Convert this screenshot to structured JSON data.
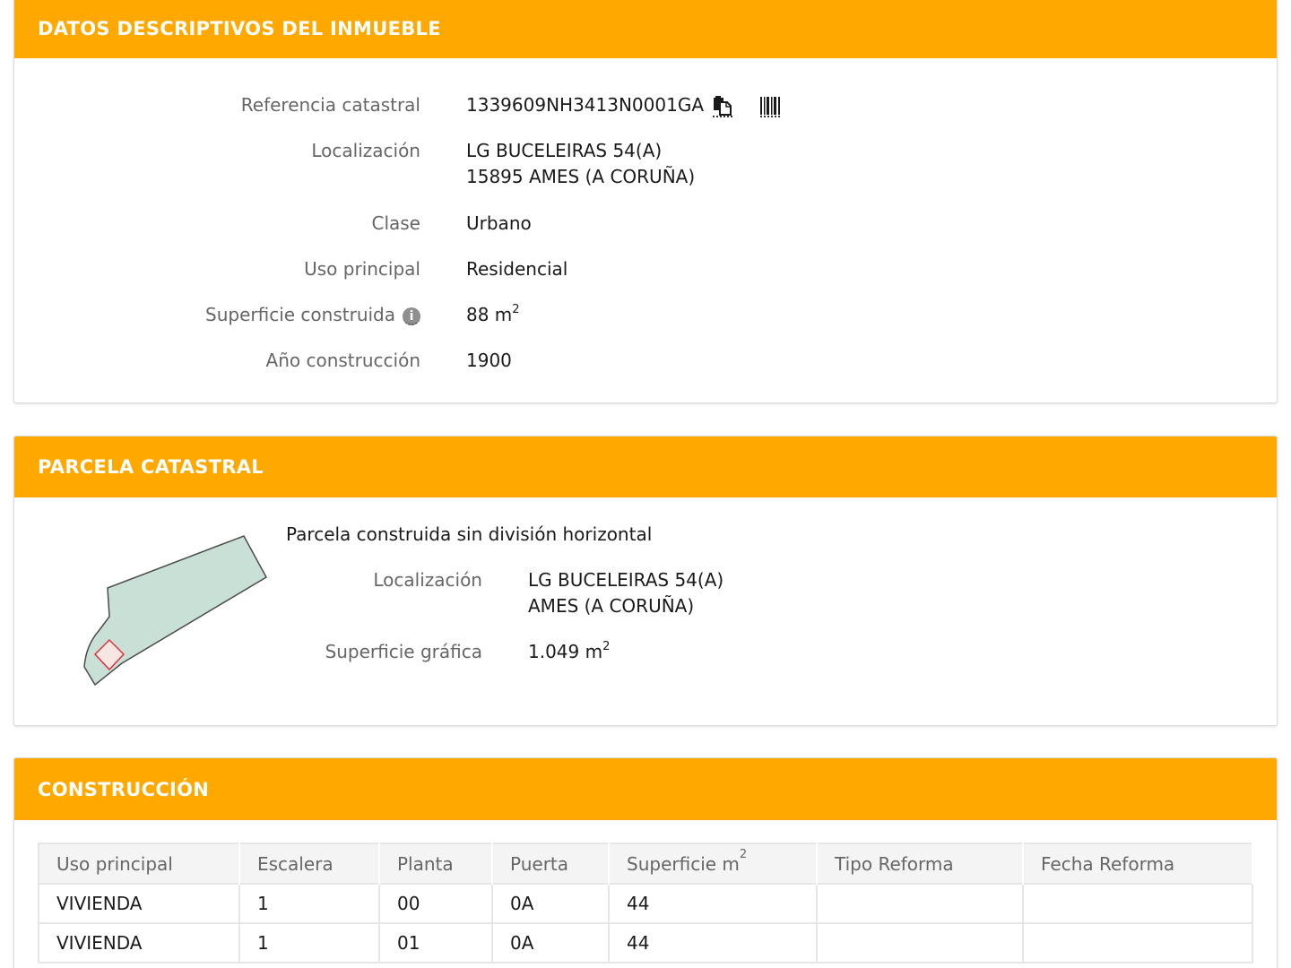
{
  "inmueble": {
    "title": "DATOS DESCRIPTIVOS DEL INMUEBLE",
    "ref_label": "Referencia catastral",
    "ref_value": "1339609NH3413N0001GA",
    "loc_label": "Localización",
    "loc_line1": "LG BUCELEIRAS 54(A)",
    "loc_line2": "15895 AMES (A CORUÑA)",
    "clase_label": "Clase",
    "clase_value": "Urbano",
    "uso_label": "Uso principal",
    "uso_value": "Residencial",
    "sup_label": "Superficie construida",
    "sup_value": "88 m",
    "sup_exp": "2",
    "anio_label": "Año construcción",
    "anio_value": "1900"
  },
  "parcela": {
    "title": "PARCELA CATASTRAL",
    "subtitle": "Parcela construida sin división horizontal",
    "loc_label": "Localización",
    "loc_line1": "LG BUCELEIRAS 54(A)",
    "loc_line2": "AMES (A CORUÑA)",
    "sup_label": "Superficie gráfica",
    "sup_value": "1.049 m",
    "sup_exp": "2"
  },
  "construccion": {
    "title": "CONSTRUCCIÓN",
    "headers": [
      "Uso principal",
      "Escalera",
      "Planta",
      "Puerta",
      "Superficie m",
      "Tipo Reforma",
      "Fecha Reforma"
    ],
    "sup_header_exp": "2",
    "rows": [
      [
        "VIVIENDA",
        "1",
        "00",
        "0A",
        "44",
        "",
        ""
      ],
      [
        "VIVIENDA",
        "1",
        "01",
        "0A",
        "44",
        "",
        ""
      ]
    ]
  },
  "icons": {
    "copy": "copy-icon",
    "barcode": "barcode-icon",
    "info": "info-icon"
  },
  "colors": {
    "header": "#ffa800",
    "parcel_fill": "#c8e0d6",
    "building_outline": "#e0303a"
  }
}
